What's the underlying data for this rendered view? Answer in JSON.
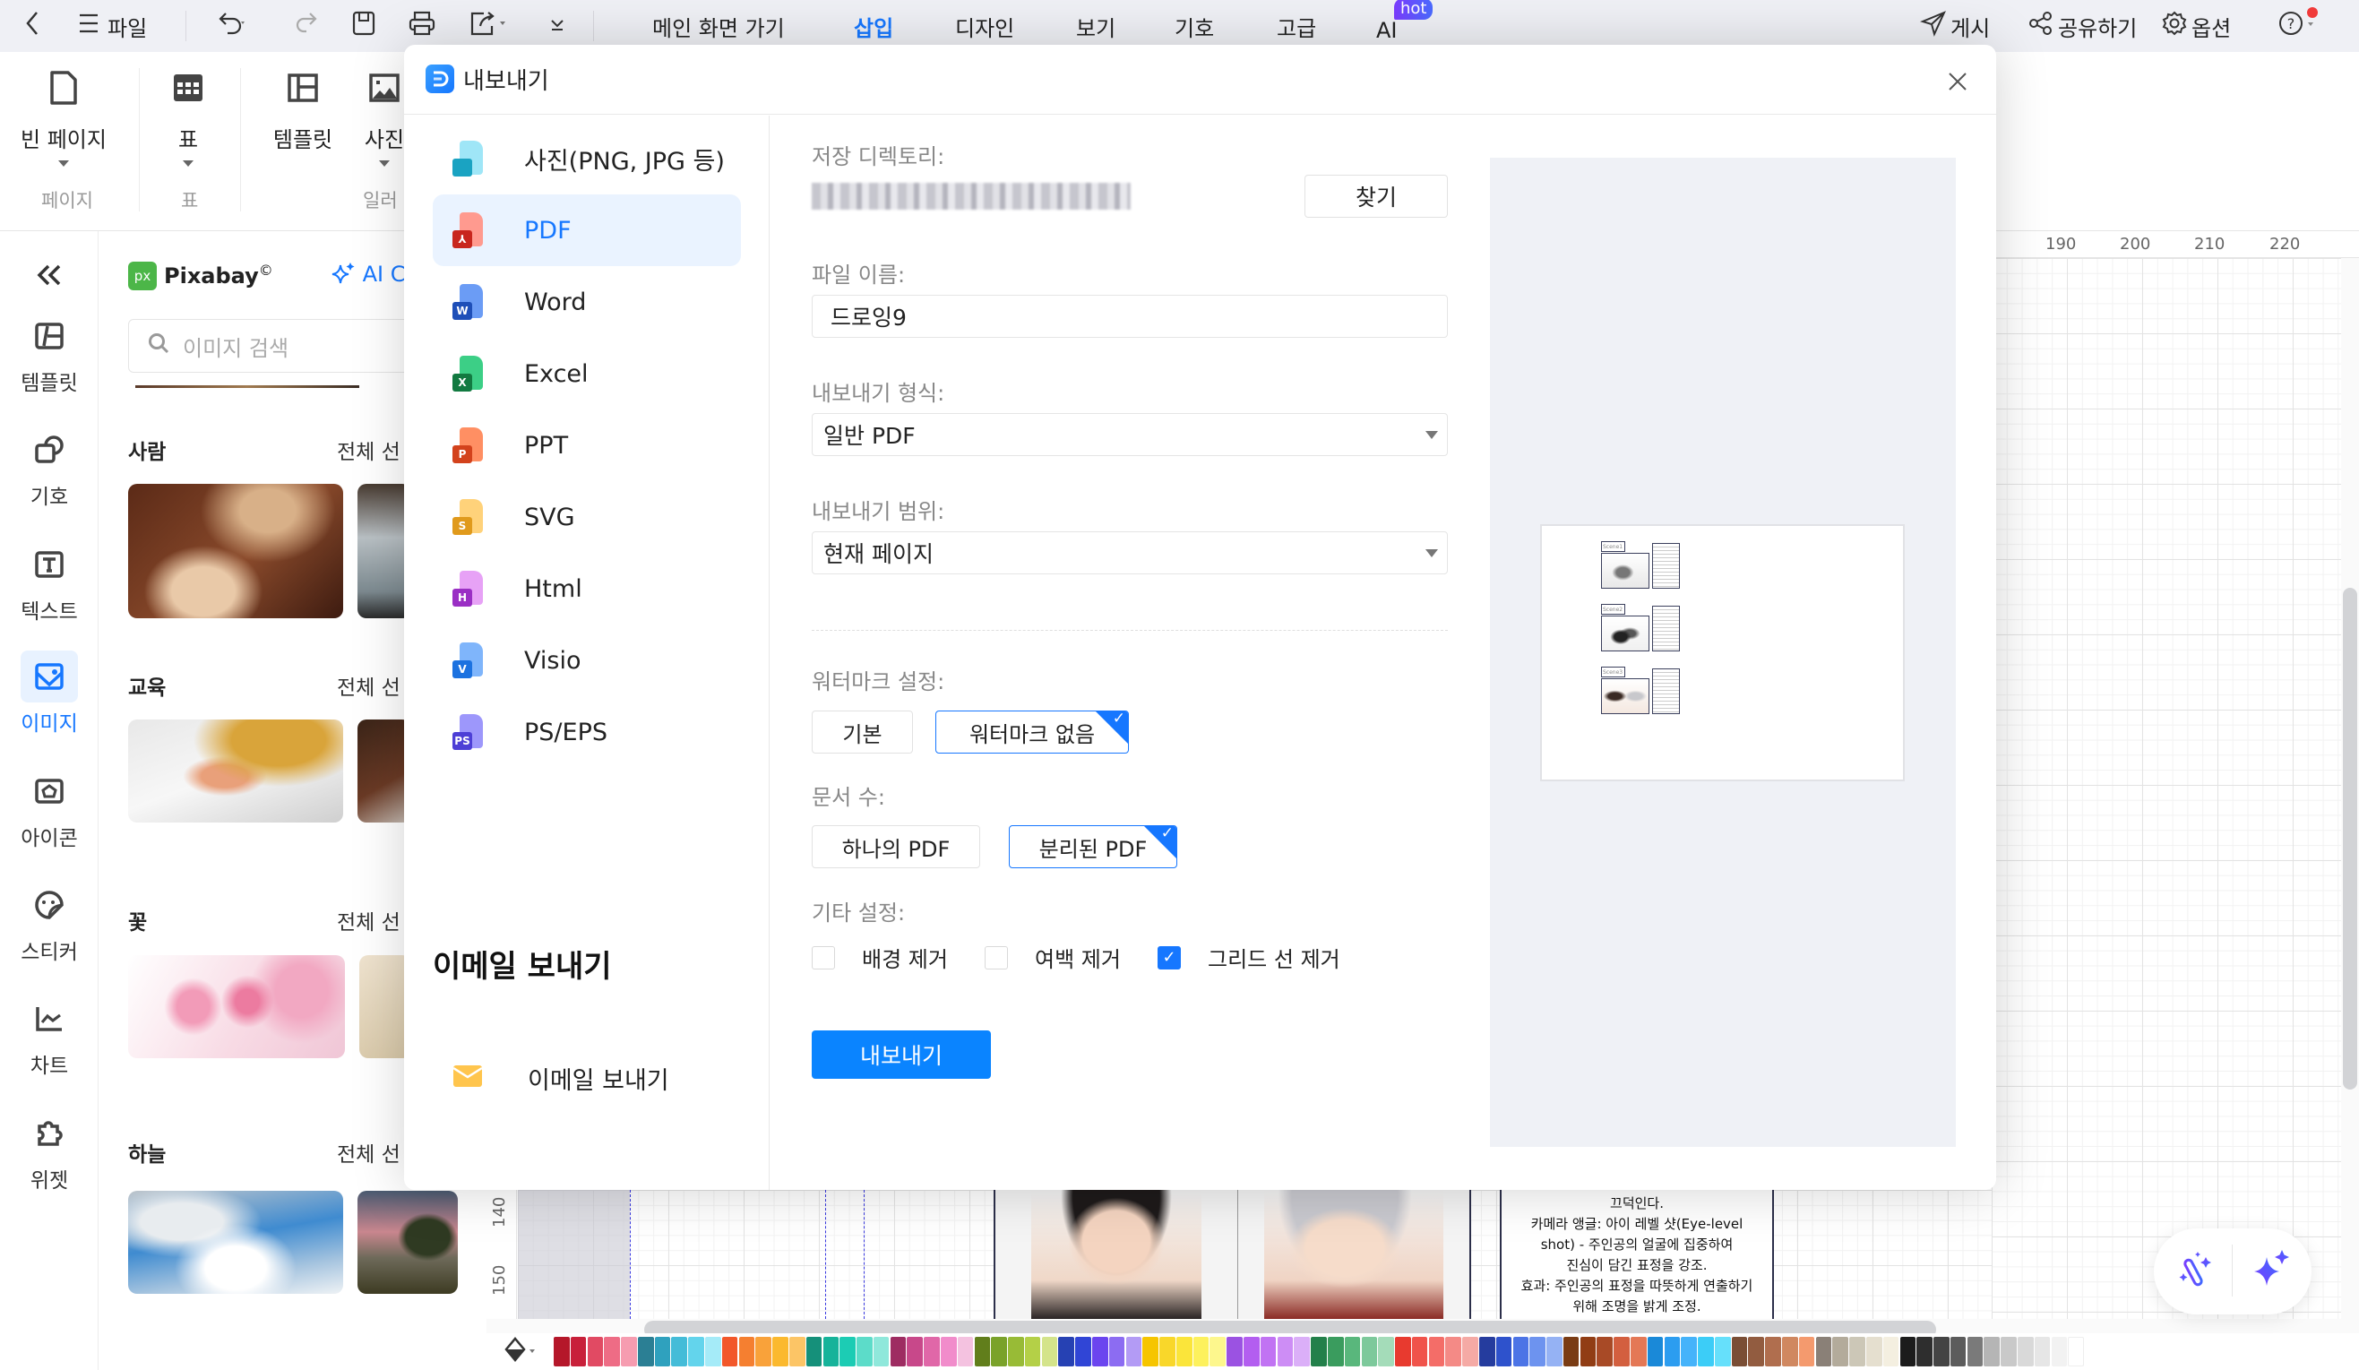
{
  "topbar": {
    "back_icon": "chevron-left-icon",
    "file_menu": "파일",
    "tabs": [
      {
        "label": "메인 화면 가기",
        "active": false
      },
      {
        "label": "삽입",
        "active": true
      },
      {
        "label": "디자인",
        "active": false
      },
      {
        "label": "보기",
        "active": false
      },
      {
        "label": "기호",
        "active": false
      },
      {
        "label": "고급",
        "active": false
      },
      {
        "label": "AI",
        "active": false
      }
    ],
    "ai_badge": "hot",
    "publish": "게시",
    "share": "공유하기",
    "options": "옵션"
  },
  "ribbon": {
    "buttons": [
      {
        "label": "빈 페이지",
        "icon": "blank-page-icon"
      },
      {
        "label": "표",
        "icon": "table-icon"
      },
      {
        "label": "템플릿",
        "icon": "template-icon"
      },
      {
        "label": "사진",
        "icon": "image-icon"
      }
    ],
    "groups": [
      "페이지",
      "표",
      "일러"
    ]
  },
  "sidebar": {
    "items": [
      {
        "label": "템플릿",
        "icon": "template-icon"
      },
      {
        "label": "기호",
        "icon": "symbol-icon"
      },
      {
        "label": "텍스트",
        "icon": "text-icon"
      },
      {
        "label": "이미지",
        "icon": "image-icon",
        "active": true
      },
      {
        "label": "아이콘",
        "icon": "icon-library-icon"
      },
      {
        "label": "스티커",
        "icon": "sticker-icon"
      },
      {
        "label": "차트",
        "icon": "chart-icon"
      },
      {
        "label": "위젯",
        "icon": "widget-icon"
      }
    ]
  },
  "pixabay": {
    "logo_text": "px",
    "name": "Pixabay",
    "copyright": "©",
    "ai_label": "AI C",
    "search_placeholder": "이미지 검색",
    "categories": [
      {
        "title": "사람",
        "all": "전체 선"
      },
      {
        "title": "교육",
        "all": "전체 선"
      },
      {
        "title": "꽃",
        "all": "전체 선"
      },
      {
        "title": "하늘",
        "all": "전체 선"
      }
    ]
  },
  "canvas": {
    "ruler_top": [
      "190",
      "200",
      "210",
      "220"
    ],
    "ruler_left": [
      "140",
      "150"
    ],
    "note_lines": [
      "끄덕인다.",
      "카메라 앵글: 아이 레벨 샷(Eye-level",
      "shot) - 주인공의 얼굴에 집중하여",
      "진심이 담긴 표정을 강조.",
      "효과: 주인공의 표정을 따뜻하게 연출하기",
      "위해 조명을 밝게 조정."
    ]
  },
  "palette": {
    "colors": [
      "#b5172a",
      "#c8203a",
      "#e14a63",
      "#ee6c85",
      "#f69cb0",
      "#2b7f94",
      "#2fa1be",
      "#44bcd8",
      "#63d4ec",
      "#a5ebf8",
      "#f2572a",
      "#f57f30",
      "#f9a23a",
      "#fbb92e",
      "#fcc566",
      "#15907a",
      "#16b39a",
      "#1cccb4",
      "#5cdcc9",
      "#8fe8db",
      "#9e2c62",
      "#c8488a",
      "#e067a8",
      "#f18ccb",
      "#f4c2e0",
      "#617e1b",
      "#7aa22a",
      "#98bb36",
      "#b4d047",
      "#d4e48b",
      "#2641b3",
      "#3045d6",
      "#6b45ef",
      "#8c6cf2",
      "#b39bf5",
      "#f6c500",
      "#f9d72a",
      "#fbe53a",
      "#fdf15d",
      "#fdf78d",
      "#9b52e2",
      "#b35ef0",
      "#c173f3",
      "#cd8df5",
      "#dbaff8",
      "#23804a",
      "#3a9c5e",
      "#59b77c",
      "#7dc99b",
      "#a4dcb9",
      "#e83a2f",
      "#f0534b",
      "#f46d68",
      "#f48a86",
      "#f5aaa5",
      "#253c9e",
      "#2e52cc",
      "#4c74e6",
      "#6d93ef",
      "#95b2f4",
      "#7a3c14",
      "#913d14",
      "#a84a26",
      "#d35f3f",
      "#e47856",
      "#1a89d8",
      "#2c9df0",
      "#45b3fa",
      "#3ccdf7",
      "#66e0fb",
      "#7a4e35",
      "#925c40",
      "#b06e4e",
      "#d08860",
      "#f49a6e",
      "#8a8077",
      "#b3ab9b",
      "#ccc7b7",
      "#e5dfcf",
      "#f4efe0",
      "#1c1c1c",
      "#2e2e2e",
      "#444444",
      "#5c5c5c",
      "#7a7a7a",
      "#b5b5b5",
      "#c9c9c9",
      "#d9d9d9",
      "#e6e6e6",
      "#f2f2f2",
      "#ffffff"
    ]
  },
  "dialog": {
    "title": "내보내기",
    "close_icon": "close-icon",
    "formats": [
      {
        "label": "사진(PNG, JPG 등)",
        "badge": "",
        "color_back": "#9fe6f7",
        "color_front": "#1aa3c2",
        "icon": "image-file-icon"
      },
      {
        "label": "PDF",
        "badge": "⅄",
        "color_back": "#ff9a8f",
        "color_front": "#c8261d",
        "icon": "pdf-file-icon",
        "active": true
      },
      {
        "label": "Word",
        "badge": "W",
        "color_back": "#6b9cf5",
        "color_front": "#1e4fb8",
        "icon": "word-file-icon"
      },
      {
        "label": "Excel",
        "badge": "X",
        "color_back": "#3ccf86",
        "color_front": "#127a41",
        "icon": "excel-file-icon"
      },
      {
        "label": "PPT",
        "badge": "P",
        "color_back": "#ff8f63",
        "color_front": "#d3421c",
        "icon": "ppt-file-icon"
      },
      {
        "label": "SVG",
        "badge": "S",
        "color_back": "#ffd27a",
        "color_front": "#e09a1c",
        "icon": "svg-file-icon"
      },
      {
        "label": "Html",
        "badge": "H",
        "color_back": "#e7a2f6",
        "color_front": "#9a2fc4",
        "icon": "html-file-icon"
      },
      {
        "label": "Visio",
        "badge": "V",
        "color_back": "#7fb5fb",
        "color_front": "#1c72e0",
        "icon": "visio-file-icon"
      },
      {
        "label": "PS/EPS",
        "badge": "PS",
        "color_back": "#9d97fb",
        "color_front": "#4d3fd6",
        "icon": "ps-eps-file-icon"
      }
    ],
    "email_heading": "이메일 보내기",
    "email_item": "이메일 보내기",
    "form": {
      "save_dir_label": "저장 디렉토리:",
      "find_button": "찾기",
      "file_name_label": "파일 이름:",
      "file_name_value": "드로잉9",
      "format_label": "내보내기 형식:",
      "format_value": "일반 PDF",
      "range_label": "내보내기 범위:",
      "range_value": "현재 페이지",
      "watermark_label": "워터마크 설정:",
      "watermark_options": [
        {
          "label": "기본",
          "selected": false
        },
        {
          "label": "워터마크 없음",
          "selected": true
        }
      ],
      "doc_count_label": "문서 수:",
      "doc_count_options": [
        {
          "label": "하나의 PDF",
          "selected": false
        },
        {
          "label": "분리된 PDF",
          "selected": true
        }
      ],
      "other_label": "기타 설정:",
      "other_options": [
        {
          "label": "배경 제거",
          "checked": false
        },
        {
          "label": "여백 제거",
          "checked": false
        },
        {
          "label": "그리드 선 제거",
          "checked": true
        }
      ],
      "export_button": "내보내기"
    },
    "preview": {
      "scenes": [
        "Scene1",
        "Scene2",
        "Scene3"
      ]
    }
  }
}
